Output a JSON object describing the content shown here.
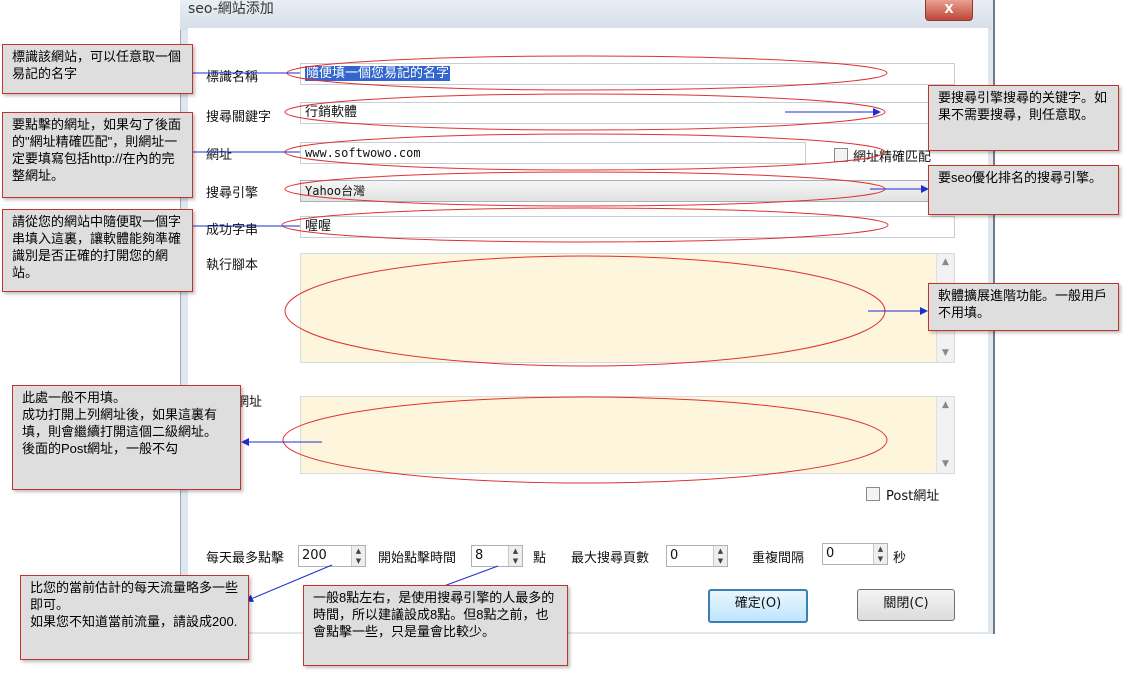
{
  "window": {
    "title": "seo-網站添加",
    "close_glyph": "X"
  },
  "form": {
    "name_label": "標識名稱",
    "name_value": "隨便填一個您易記的名字",
    "keyword_label": "搜尋關鍵字",
    "keyword_value": "行銷軟體",
    "url_label": "網址",
    "url_value": "www.softwowo.com",
    "exact_match_label": "網址精確匹配",
    "engine_label": "搜尋引擎",
    "engine_value": "Yahoo台灣",
    "success_label": "成功字串",
    "success_value": "喔喔",
    "script_label": "執行腳本",
    "second_url_label": "網址",
    "post_url_label": "Post網址",
    "max_clicks_label": "每天最多點擊",
    "max_clicks_value": "200",
    "start_time_label": "開始點擊時間",
    "start_time_value": "8",
    "start_time_unit": "點",
    "max_pages_label": "最大搜尋頁數",
    "max_pages_value": "0",
    "repeat_label": "重複間隔",
    "repeat_value": "0",
    "repeat_unit": "秒",
    "ok_button": "確定(O)",
    "close_button": "關閉(C)"
  },
  "annotations": {
    "name": "標識該網站，可以任意取一個易記的名字",
    "keyword": "要搜尋引擎搜尋的关键字。如果不需要搜尋，則任意取。",
    "url": "要點擊的網址，如果勾了後面的\"網址精確匹配\"，則網址一定要填寫包括http://在內的完整網址。",
    "engine": "要seo優化排名的搜尋引擎。",
    "success": "請從您的網站中隨便取一個字串填入這裏，讓軟體能夠準確識別是否正確的打開您的網站。",
    "script": "軟體擴展進階功能。一般用戶不用填。",
    "second_url_line1": "此處一般不用填。",
    "second_url_line2": "成功打開上列網址後，如果這裏有填，則會繼續打開這個二級網址。",
    "second_url_line3": "後面的Post網址，一般不勾",
    "clicks_line1": "比您的當前估計的每天流量略多一些即可。",
    "clicks_line2": "如果您不知道當前流量，請設成200.",
    "time": "一般8點左右，是使用搜尋引擎的人最多的時間，所以建議設成8點。但8點之前，也會點擊一些，只是量會比較少。"
  },
  "colors": {
    "annotation_border": "#c0342c",
    "annotation_bg": "#dedede",
    "arrow": "#1a2fd0",
    "ellipse": "#e23030",
    "textarea_bg": "#fdf5dc"
  }
}
